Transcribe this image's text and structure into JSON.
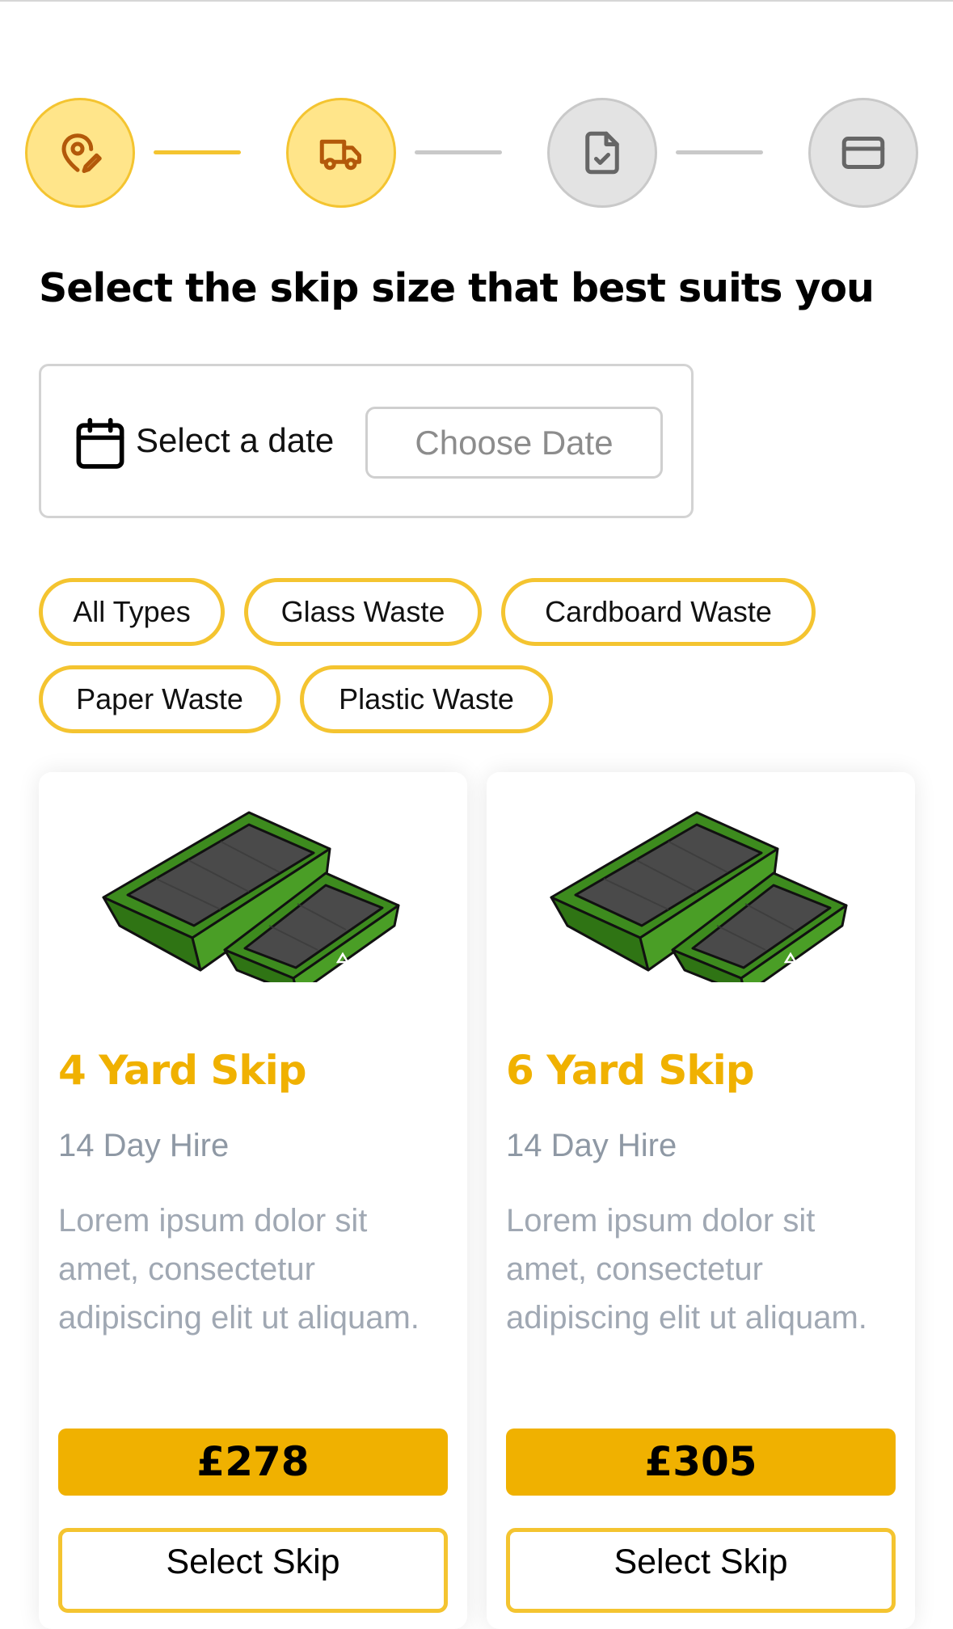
{
  "stepper": {
    "steps": [
      {
        "icon": "map-pin-edit-icon",
        "state": "complete"
      },
      {
        "icon": "truck-icon",
        "state": "current"
      },
      {
        "icon": "file-check-icon",
        "state": "upcoming"
      },
      {
        "icon": "credit-card-icon",
        "state": "upcoming"
      }
    ]
  },
  "page": {
    "title": "Select the skip size that best suits you"
  },
  "date_picker": {
    "label": "Select a date",
    "placeholder": "Choose Date"
  },
  "filters": [
    "All Types",
    "Glass Waste",
    "Cardboard Waste",
    "Paper Waste",
    "Plastic Waste"
  ],
  "skips": [
    {
      "title": "4 Yard Skip",
      "hire": "14 Day Hire",
      "description": "Lorem ipsum dolor sit amet, consectetur adipiscing elit ut aliquam.",
      "price": "£278",
      "select_label": "Select Skip"
    },
    {
      "title": "6 Yard Skip",
      "hire": "14 Day Hire",
      "description": "Lorem ipsum dolor sit amet, consectetur adipiscing elit ut aliquam.",
      "price": "£305",
      "select_label": "Select Skip"
    }
  ],
  "colors": {
    "accent": "#f4c430",
    "price_bg": "#f0b100",
    "step_active_bg": "#ffe58a",
    "step_inactive_bg": "#e3e3e3",
    "title_color": "#f0b100",
    "muted_text": "#a0a8b3"
  }
}
